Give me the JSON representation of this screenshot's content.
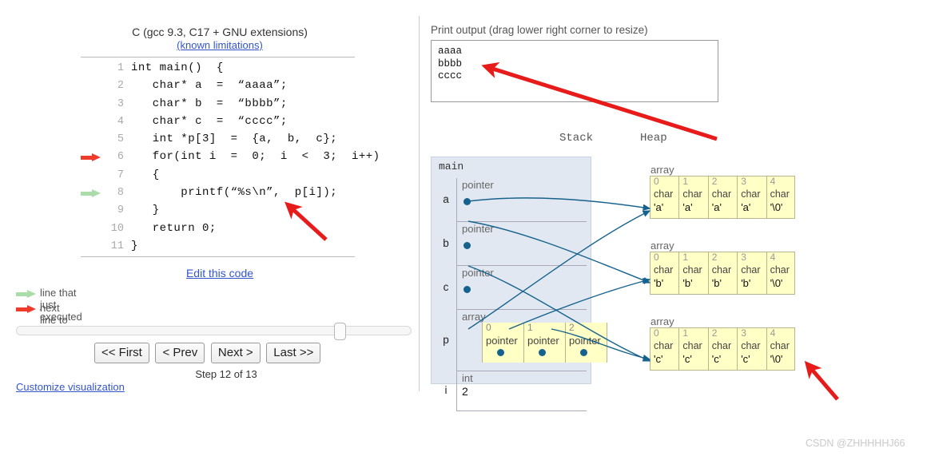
{
  "code_panel": {
    "language_title": "C (gcc 9.3, C17 + GNU extensions)",
    "known_limitations_label": "(known limitations)",
    "edit_code_label": "Edit this code",
    "lines": [
      {
        "no": "1",
        "text": "int main()  {",
        "marker": "none"
      },
      {
        "no": "2",
        "text": "   char* a  =  “aaaa”;",
        "marker": "none"
      },
      {
        "no": "3",
        "text": "   char* b  =  “bbbb”;",
        "marker": "none"
      },
      {
        "no": "4",
        "text": "   char* c  =  “cccc”;",
        "marker": "none"
      },
      {
        "no": "5",
        "text": "   int *p[3]  =  {a,  b,  c};",
        "marker": "none"
      },
      {
        "no": "6",
        "text": "   for(int i  =  0;  i  <  3;  i++)",
        "marker": "red"
      },
      {
        "no": "7",
        "text": "   {",
        "marker": "none"
      },
      {
        "no": "8",
        "text": "       printf(“%s\\n”,  p[i]);",
        "marker": "green"
      },
      {
        "no": "9",
        "text": "   }",
        "marker": "none"
      },
      {
        "no": "10",
        "text": "   return 0;",
        "marker": "none"
      },
      {
        "no": "11",
        "text": "}",
        "marker": "none"
      }
    ]
  },
  "legend": {
    "just_executed": "line that just executed",
    "next_line": "next line to execute",
    "green_color": "#aaddaa",
    "red_color": "#ef3b2c"
  },
  "controls": {
    "first_label": "<< First",
    "prev_label": "< Prev",
    "next_label": "Next >",
    "last_label": "Last >>",
    "step_label": "Step 12 of 13",
    "customize_label": "Customize visualization",
    "slider_position_percent": 83
  },
  "output": {
    "label": "Print output (drag lower right corner to resize)",
    "text": "aaaa\nbbbb\ncccc"
  },
  "viz": {
    "stack_title": "Stack",
    "heap_title": "Heap",
    "frame_name": "main",
    "stack_vars": [
      {
        "name": "a",
        "type": "pointer",
        "value": ""
      },
      {
        "name": "b",
        "type": "pointer",
        "value": ""
      },
      {
        "name": "c",
        "type": "pointer",
        "value": ""
      },
      {
        "name": "p",
        "type": "array",
        "value": ""
      },
      {
        "name": "i",
        "type": "int",
        "value": "2"
      }
    ],
    "p_array": {
      "type_label": "array",
      "cells": [
        {
          "index": "0",
          "type": "pointer"
        },
        {
          "index": "1",
          "type": "pointer"
        },
        {
          "index": "2",
          "type": "pointer"
        }
      ]
    },
    "heap_arrays": [
      {
        "label": "array",
        "cells": [
          {
            "index": "0",
            "type": "char",
            "value": "'a'"
          },
          {
            "index": "1",
            "type": "char",
            "value": "'a'"
          },
          {
            "index": "2",
            "type": "char",
            "value": "'a'"
          },
          {
            "index": "3",
            "type": "char",
            "value": "'a'"
          },
          {
            "index": "4",
            "type": "char",
            "value": "'\\0'"
          }
        ]
      },
      {
        "label": "array",
        "cells": [
          {
            "index": "0",
            "type": "char",
            "value": "'b'"
          },
          {
            "index": "1",
            "type": "char",
            "value": "'b'"
          },
          {
            "index": "2",
            "type": "char",
            "value": "'b'"
          },
          {
            "index": "3",
            "type": "char",
            "value": "'b'"
          },
          {
            "index": "4",
            "type": "char",
            "value": "'\\0'"
          }
        ]
      },
      {
        "label": "array",
        "cells": [
          {
            "index": "0",
            "type": "char",
            "value": "'c'"
          },
          {
            "index": "1",
            "type": "char",
            "value": "'c'"
          },
          {
            "index": "2",
            "type": "char",
            "value": "'c'"
          },
          {
            "index": "3",
            "type": "char",
            "value": "'c'"
          },
          {
            "index": "4",
            "type": "char",
            "value": "'\\0'"
          }
        ]
      }
    ],
    "pointer_color": "#16628c",
    "heap_cell_color": "#ffffc6",
    "stack_frame_color": "#e2e8f2"
  },
  "annotations": {
    "color": "#e81b1b",
    "count": 3
  },
  "watermark": "CSDN @ZHHHHHJ66"
}
